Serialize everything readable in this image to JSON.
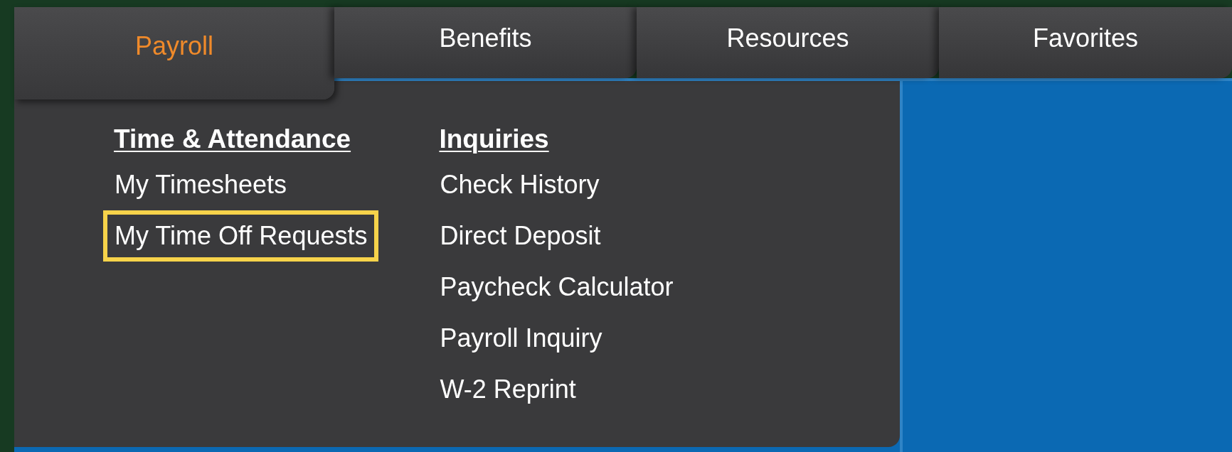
{
  "tabs": [
    {
      "label": "Payroll",
      "selected": true
    },
    {
      "label": "Benefits",
      "selected": false
    },
    {
      "label": "Resources",
      "selected": false
    },
    {
      "label": "Favorites",
      "selected": false
    }
  ],
  "menu": {
    "columns": [
      {
        "heading": "Time & Attendance",
        "items": [
          {
            "label": "My Timesheets",
            "highlighted": false
          },
          {
            "label": "My Time Off Requests",
            "highlighted": true
          }
        ]
      },
      {
        "heading": "Inquiries",
        "items": [
          {
            "label": "Check History",
            "highlighted": false
          },
          {
            "label": "Direct Deposit",
            "highlighted": false
          },
          {
            "label": "Paycheck Calculator",
            "highlighted": false
          },
          {
            "label": "Payroll Inquiry",
            "highlighted": false
          },
          {
            "label": "W-2 Reprint",
            "highlighted": false
          }
        ]
      }
    ]
  }
}
